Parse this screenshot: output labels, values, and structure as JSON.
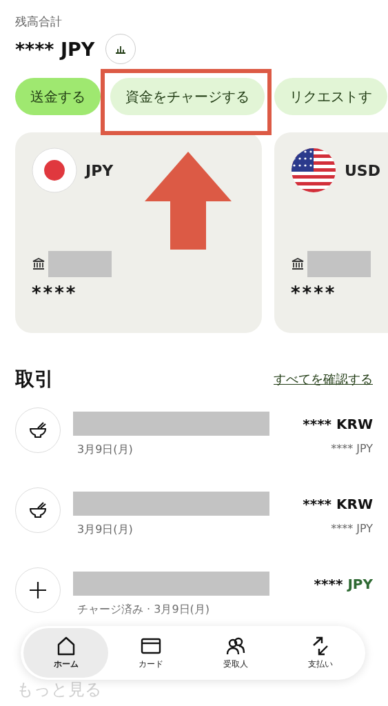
{
  "balance": {
    "label": "残高合計",
    "amount": "**** JPY"
  },
  "actions": [
    {
      "label": "送金する",
      "primary": true
    },
    {
      "label": "資金をチャージする",
      "primary": false
    },
    {
      "label": "リクエストす",
      "primary": false
    }
  ],
  "accounts": [
    {
      "kind": "jp",
      "currency": "JPY",
      "balance": "****"
    },
    {
      "kind": "us",
      "currency": "USD",
      "balance": "****"
    }
  ],
  "transactions": {
    "title": "取引",
    "see_all": "すべてを確認する",
    "rows": [
      {
        "kind": "meal",
        "subtitle": "3月9日(月)",
        "amount": "****",
        "currency": "KRW",
        "credit": false,
        "converted": "**** JPY"
      },
      {
        "kind": "meal",
        "subtitle": "3月9日(月)",
        "amount": "****",
        "currency": "KRW",
        "credit": false,
        "converted": "**** JPY"
      },
      {
        "kind": "topup",
        "subtitle": "チャージ済み · 3月9日(月)",
        "amount": "****",
        "currency": "JPY",
        "credit": true
      }
    ]
  },
  "more": "もっと見る",
  "nav": [
    {
      "kind": "home",
      "label": "ホーム",
      "selected": true
    },
    {
      "kind": "card",
      "label": "カード",
      "selected": false
    },
    {
      "kind": "people",
      "label": "受取人",
      "selected": false
    },
    {
      "kind": "swap",
      "label": "支払い",
      "selected": false
    }
  ]
}
